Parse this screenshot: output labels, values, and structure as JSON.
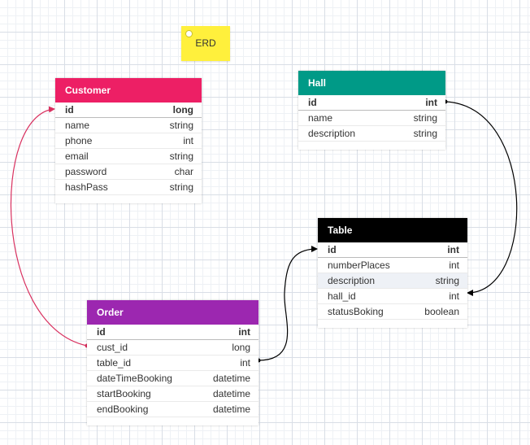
{
  "note": {
    "text": "ERD"
  },
  "colors": {
    "customer": "#ed1f65",
    "hall": "#009a87",
    "table": "#000000",
    "order": "#9c27b0",
    "link_customer": "#d9305f",
    "link_default": "#000000"
  },
  "entities": {
    "customer": {
      "title": "Customer",
      "fields": [
        {
          "name": "id",
          "type": "long"
        },
        {
          "name": "name",
          "type": "string"
        },
        {
          "name": "phone",
          "type": "int"
        },
        {
          "name": "email",
          "type": "string"
        },
        {
          "name": "password",
          "type": "char"
        },
        {
          "name": "hashPass",
          "type": "string"
        }
      ]
    },
    "hall": {
      "title": "Hall",
      "fields": [
        {
          "name": "id",
          "type": "int"
        },
        {
          "name": "name",
          "type": "string"
        },
        {
          "name": "description",
          "type": "string"
        }
      ]
    },
    "table": {
      "title": "Table",
      "fields": [
        {
          "name": "id",
          "type": "int"
        },
        {
          "name": "numberPlaces",
          "type": "int"
        },
        {
          "name": "description",
          "type": "string"
        },
        {
          "name": "hall_id",
          "type": "int"
        },
        {
          "name": "statusBoking",
          "type": "boolean"
        }
      ]
    },
    "order": {
      "title": "Order",
      "fields": [
        {
          "name": "id",
          "type": "int"
        },
        {
          "name": "cust_id",
          "type": "long"
        },
        {
          "name": "table_id",
          "type": "int"
        },
        {
          "name": "dateTimeBooking",
          "type": "datetime"
        },
        {
          "name": "startBooking",
          "type": "datetime"
        },
        {
          "name": "endBooking",
          "type": "datetime"
        }
      ]
    }
  }
}
